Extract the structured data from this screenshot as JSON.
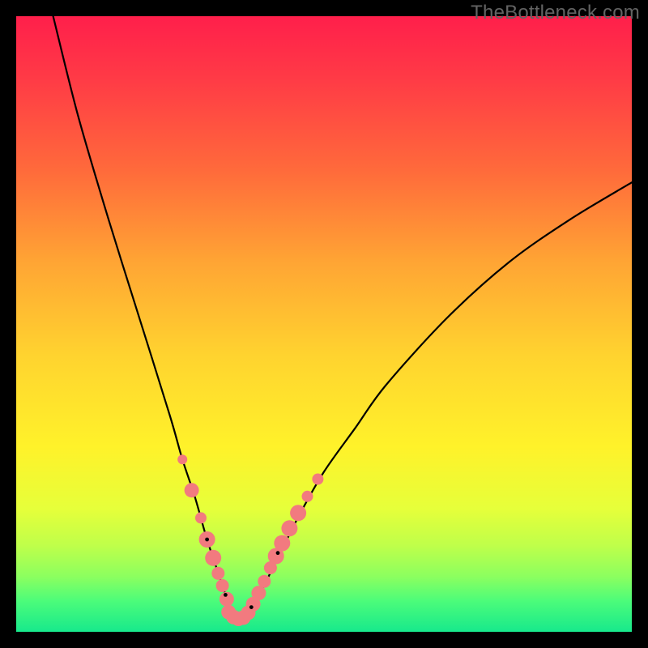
{
  "watermark": "TheBottleneck.com",
  "colors": {
    "frame": "#000000",
    "curve": "#000000",
    "dots": "#f27a7f",
    "watermark_text": "#636363",
    "gradient_top": "#ff1f4b",
    "gradient_bottom": "#17e98c"
  },
  "chart_data": {
    "type": "line",
    "title": "",
    "xlabel": "",
    "ylabel": "",
    "xlim": [
      0,
      100
    ],
    "ylim": [
      0,
      100
    ],
    "series": [
      {
        "name": "bottleneck-curve",
        "x": [
          6,
          10,
          15,
          20,
          25,
          27,
          29,
          31,
          33,
          34,
          35,
          36,
          37,
          39,
          41,
          43,
          46,
          50,
          55,
          60,
          70,
          80,
          90,
          100
        ],
        "y": [
          100,
          84,
          67,
          51,
          35,
          28,
          22,
          15,
          9,
          6,
          3,
          2,
          2.5,
          5,
          9,
          13,
          19,
          26,
          33,
          40,
          51,
          60,
          67,
          73
        ]
      }
    ],
    "marker_clusters": [
      {
        "cluster": "left-arm",
        "points": [
          {
            "x": 27,
            "y": 28,
            "r": 6
          },
          {
            "x": 28.5,
            "y": 23,
            "r": 9
          },
          {
            "x": 30,
            "y": 18.5,
            "r": 7
          },
          {
            "x": 31,
            "y": 15,
            "r": 10
          },
          {
            "x": 32,
            "y": 12,
            "r": 10
          },
          {
            "x": 32.8,
            "y": 9.5,
            "r": 8
          },
          {
            "x": 33.5,
            "y": 7.5,
            "r": 8
          },
          {
            "x": 34.2,
            "y": 5.3,
            "r": 9
          }
        ]
      },
      {
        "cluster": "trough",
        "points": [
          {
            "x": 34.5,
            "y": 3.2,
            "r": 9
          },
          {
            "x": 35.3,
            "y": 2.4,
            "r": 9
          },
          {
            "x": 36.1,
            "y": 2.1,
            "r": 9
          },
          {
            "x": 36.9,
            "y": 2.3,
            "r": 9
          },
          {
            "x": 37.7,
            "y": 3.1,
            "r": 9
          }
        ]
      },
      {
        "cluster": "right-arm",
        "points": [
          {
            "x": 38.5,
            "y": 4.5,
            "r": 9
          },
          {
            "x": 39.4,
            "y": 6.3,
            "r": 9
          },
          {
            "x": 40.3,
            "y": 8.2,
            "r": 8
          },
          {
            "x": 41.3,
            "y": 10.4,
            "r": 8
          },
          {
            "x": 42.2,
            "y": 12.3,
            "r": 10
          },
          {
            "x": 43.2,
            "y": 14.4,
            "r": 10
          },
          {
            "x": 44.4,
            "y": 16.8,
            "r": 10
          },
          {
            "x": 45.8,
            "y": 19.3,
            "r": 10
          },
          {
            "x": 47.3,
            "y": 22.0,
            "r": 7
          },
          {
            "x": 49.0,
            "y": 24.8,
            "r": 7
          }
        ]
      }
    ]
  }
}
